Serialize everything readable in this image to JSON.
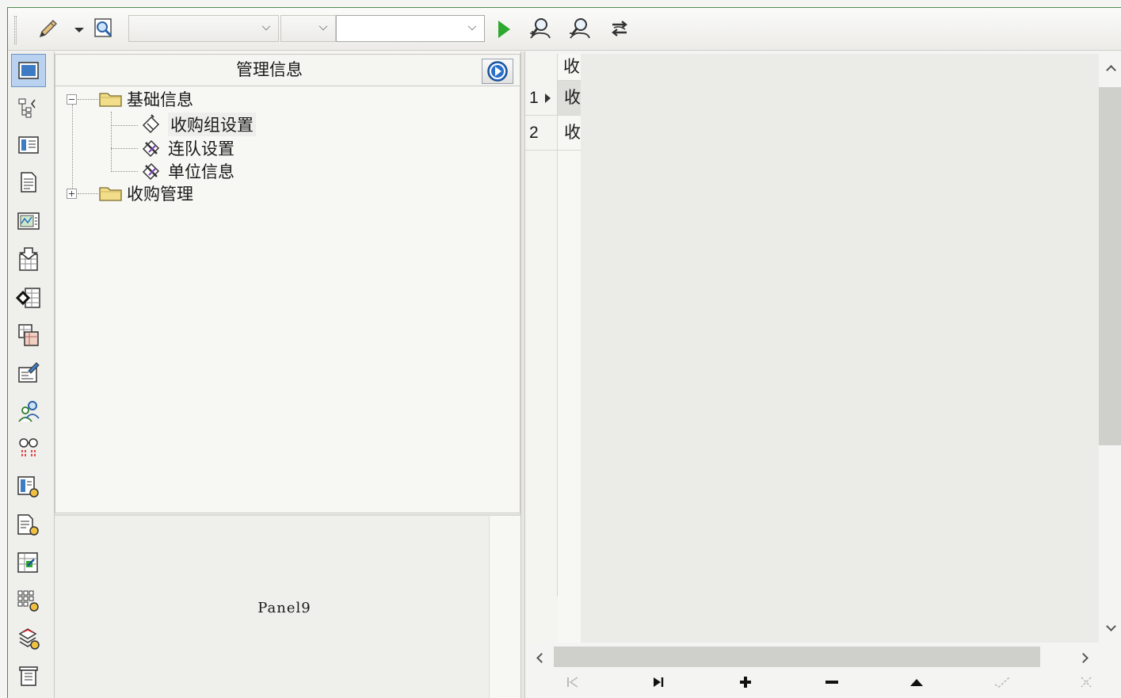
{
  "toolbar": {
    "combo1_value": "",
    "combo2_value": "",
    "combo3_value": ""
  },
  "icons": {
    "toolbar": [
      "pencil-icon",
      "dropdown-arrow-icon",
      "find-form-icon",
      "run-icon",
      "zoom-in-user-icon",
      "zoom-out-user-icon",
      "refresh-link-icon"
    ],
    "strip": [
      "window-icon",
      "org-chart-icon",
      "list-form-icon",
      "document-icon",
      "chart-icon",
      "inbox-grid-icon",
      "export-grid-icon",
      "cards-icon",
      "edit-form-icon",
      "users-icon",
      "glasses-icon",
      "report-settings-icon",
      "doc-settings-icon",
      "grid-export-icon",
      "grid-settings-icon",
      "stack-settings-icon",
      "trash-icon"
    ],
    "grid_nav": [
      "first-record-icon",
      "last-record-icon",
      "insert-record-icon",
      "delete-record-icon",
      "edit-record-icon",
      "post-record-icon",
      "cancel-record-icon"
    ]
  },
  "tree": {
    "title": "管理信息",
    "nodes": [
      {
        "label": "基础信息",
        "type": "folder",
        "expanded": true
      },
      {
        "label": "收购组设置",
        "type": "item"
      },
      {
        "label": "连队设置",
        "type": "item"
      },
      {
        "label": "单位信息",
        "type": "item"
      },
      {
        "label": "收购管理",
        "type": "folder",
        "expanded": false
      }
    ]
  },
  "panel9": {
    "label": "Panel9"
  },
  "grid": {
    "header": "收",
    "rows": [
      {
        "num": "1",
        "value": "收",
        "current": true
      },
      {
        "num": "2",
        "value": "收",
        "current": false
      }
    ]
  },
  "colors": {
    "border_green": "#4f8a4f",
    "active_blue": "#b8d2ef",
    "run_green": "#2fa82f"
  }
}
